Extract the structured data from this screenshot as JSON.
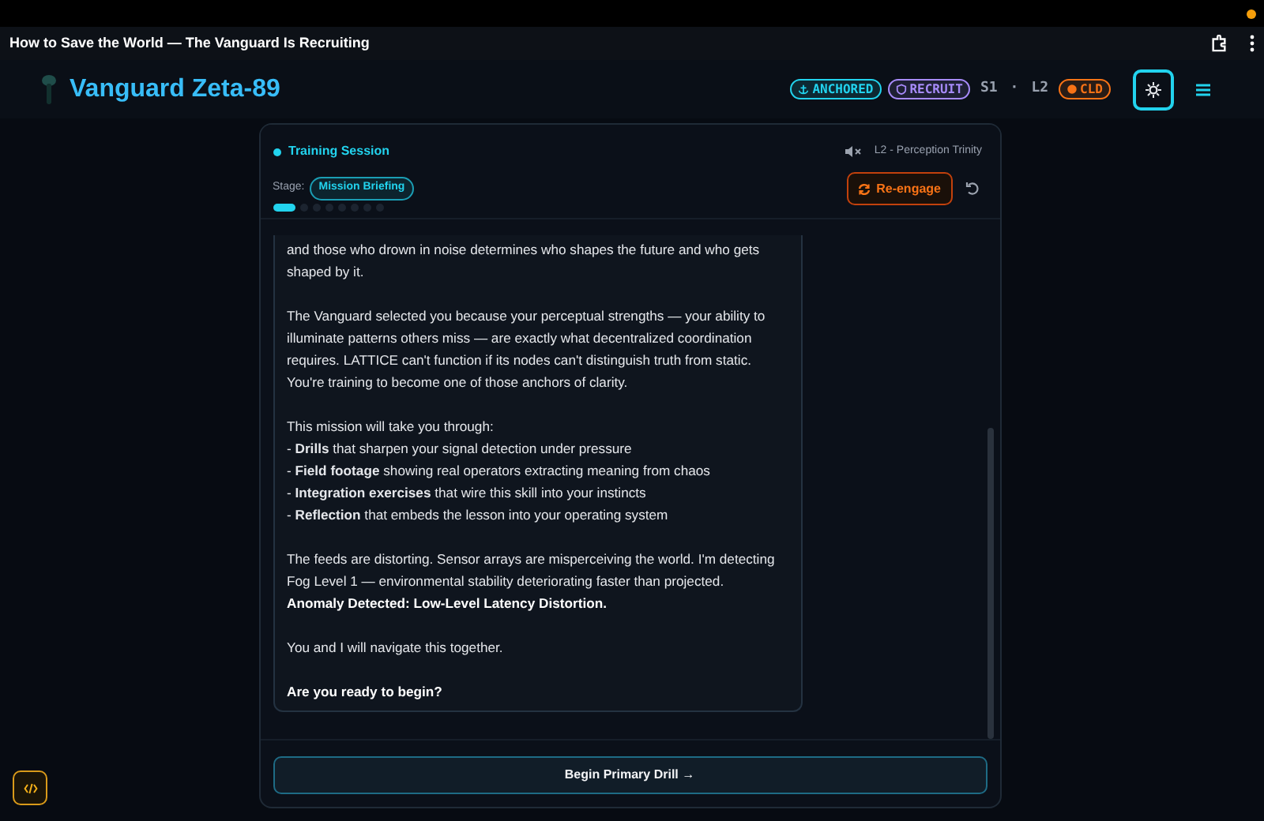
{
  "browser": {
    "title": "How to Save the World — The Vanguard Is Recruiting"
  },
  "header": {
    "title": "Vanguard Zeta-89",
    "badges": [
      {
        "kind": "anchor",
        "label": "ANCHORED",
        "color": "#22d3ee"
      },
      {
        "kind": "shield",
        "label": "RECRUIT",
        "color": "#a78bfa"
      },
      {
        "kind": "plain",
        "label": "S1"
      },
      {
        "kind": "dot",
        "label": "·"
      },
      {
        "kind": "plain",
        "label": "L2"
      },
      {
        "kind": "coin",
        "label": "CLD",
        "color": "#f97316"
      }
    ],
    "settings_active": true
  },
  "session": {
    "title": "Training Session",
    "muted": true,
    "level_name": "L2 - Perception Trinity",
    "stage_label": "Stage:",
    "stage": "Mission Briefing",
    "reengage": "Re-engage",
    "steps": [
      {
        "selected": true
      },
      {
        "selected": false
      },
      {
        "selected": false
      },
      {
        "selected": false
      },
      {
        "selected": false
      },
      {
        "selected": false
      },
      {
        "selected": false
      },
      {
        "selected": false
      }
    ],
    "message": [
      {
        "kind": "para",
        "text": "and those who drown in noise determines who shapes the future and who gets shaped by it."
      },
      {
        "kind": "gap"
      },
      {
        "kind": "para",
        "text": "The Vanguard selected you because your perceptual strengths — your ability to illuminate patterns others miss — are exactly what decentralized coordination requires. LATTICE can't function if its nodes can't distinguish truth from static. You're training to become one of those anchors of clarity."
      },
      {
        "kind": "gap"
      },
      {
        "kind": "para",
        "text": "This mission will take you through:"
      },
      {
        "kind": "para",
        "text": "- **Drills** that sharpen your signal detection under pressure"
      },
      {
        "kind": "para",
        "text": "- **Field footage** showing real operators extracting meaning from chaos"
      },
      {
        "kind": "para",
        "text": "- **Integration exercises** that wire this skill into your instincts"
      },
      {
        "kind": "para",
        "text": "- **Reflection** that embeds the lesson into your operating system"
      },
      {
        "kind": "gap"
      },
      {
        "kind": "para",
        "text": "The feeds are distorting. Sensor arrays are misperceiving the world. I'm detecting Fog Level 1 — environmental stability deteriorating faster than projected."
      },
      {
        "kind": "bold",
        "text": "Anomaly Detected: Low-Level Latency Distortion."
      },
      {
        "kind": "gap"
      },
      {
        "kind": "para",
        "text": "You and I will navigate this together."
      },
      {
        "kind": "gap"
      },
      {
        "kind": "bold",
        "text": "Are you ready to begin?"
      }
    ],
    "action": "Begin Primary Drill →"
  }
}
